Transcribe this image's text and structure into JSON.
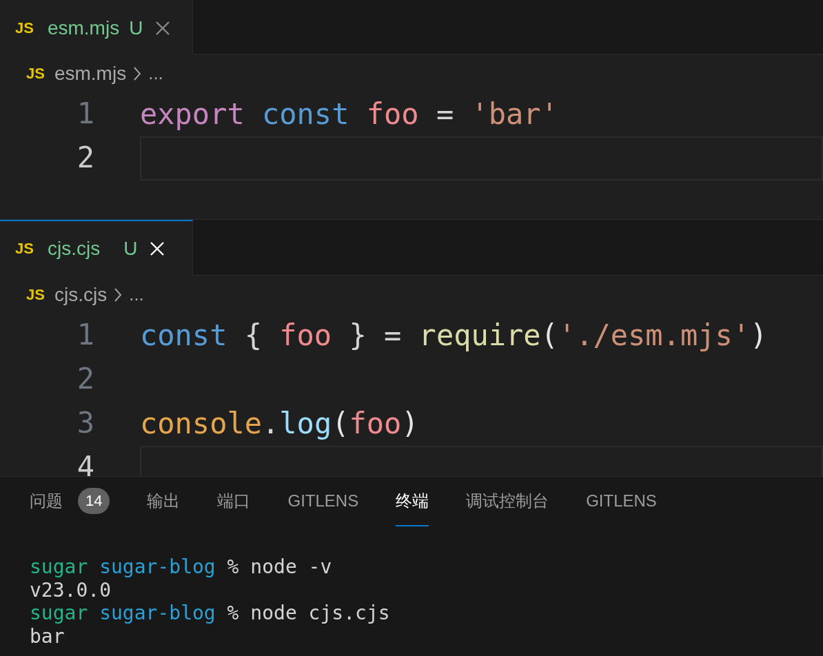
{
  "editor_groups": [
    {
      "focused": false,
      "tab": {
        "icon_text": "JS",
        "name": "esm.mjs",
        "status": "U"
      },
      "breadcrumb": {
        "icon_text": "JS",
        "file": "esm.mjs",
        "more": "..."
      },
      "lines": [
        {
          "number": "1",
          "current": false,
          "tokens": [
            {
              "text": "export ",
              "kind": "keyword"
            },
            {
              "text": "const ",
              "kind": "storage"
            },
            {
              "text": "foo",
              "kind": "variable"
            },
            {
              "text": " = ",
              "kind": "plain"
            },
            {
              "text": "'bar'",
              "kind": "string"
            }
          ]
        },
        {
          "number": "2",
          "current": true
        }
      ]
    },
    {
      "focused": true,
      "tab": {
        "icon_text": "JS",
        "name": "cjs.cjs",
        "status": "U"
      },
      "breadcrumb": {
        "icon_text": "JS",
        "file": "cjs.cjs",
        "more": "..."
      },
      "lines": [
        {
          "number": "1",
          "current": false,
          "tokens": [
            {
              "text": "const",
              "kind": "storage"
            },
            {
              "text": " { ",
              "kind": "plain"
            },
            {
              "text": "foo",
              "kind": "variable"
            },
            {
              "text": " } = ",
              "kind": "plain"
            },
            {
              "text": "require",
              "kind": "function"
            },
            {
              "text": "(",
              "kind": "paren"
            },
            {
              "text": "'./esm.mjs'",
              "kind": "string"
            },
            {
              "text": ")",
              "kind": "paren"
            }
          ]
        },
        {
          "number": "2",
          "current": false
        },
        {
          "number": "3",
          "current": false,
          "tokens": [
            {
              "text": "console",
              "kind": "object"
            },
            {
              "text": ".",
              "kind": "plain"
            },
            {
              "text": "log",
              "kind": "method"
            },
            {
              "text": "(",
              "kind": "paren"
            },
            {
              "text": "foo",
              "kind": "variable"
            },
            {
              "text": ")",
              "kind": "paren"
            }
          ]
        },
        {
          "number": "4",
          "current": true
        }
      ]
    }
  ],
  "panel": {
    "tabs": [
      {
        "label": "问题",
        "badge": "14",
        "selected": false
      },
      {
        "label": "输出",
        "selected": false
      },
      {
        "label": "端口",
        "selected": false
      },
      {
        "label": "GITLENS",
        "selected": false
      },
      {
        "label": "终端",
        "selected": true
      },
      {
        "label": "调试控制台",
        "selected": false
      },
      {
        "label": "GITLENS",
        "selected": false
      }
    ],
    "terminal_lines": [
      [
        {
          "text": "sugar ",
          "kind": "user"
        },
        {
          "text": "sugar-blog",
          "kind": "dir"
        },
        {
          "text": " % node -v",
          "kind": "plain"
        }
      ],
      [
        {
          "text": "v23.0.0",
          "kind": "plain"
        }
      ],
      [
        {
          "text": "sugar ",
          "kind": "user"
        },
        {
          "text": "sugar-blog",
          "kind": "dir"
        },
        {
          "text": " % node cjs.cjs",
          "kind": "plain"
        }
      ],
      [
        {
          "text": "bar",
          "kind": "plain"
        }
      ]
    ]
  }
}
